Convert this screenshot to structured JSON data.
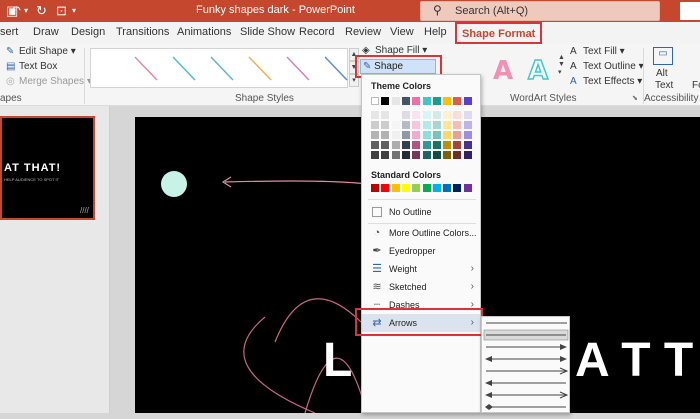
{
  "titlebar": {
    "autosave": "⏺",
    "undo_icon": "undo-icon",
    "document_title": "Funky shapes dark  -  PowerPoint",
    "search_placeholder": "Search (Alt+Q)",
    "accent": "#c4472e"
  },
  "tabs": [
    {
      "label": "sert"
    },
    {
      "label": "Draw"
    },
    {
      "label": "Design"
    },
    {
      "label": "Transitions"
    },
    {
      "label": "Animations"
    },
    {
      "label": "Slide Show"
    },
    {
      "label": "Record"
    },
    {
      "label": "Review"
    },
    {
      "label": "View"
    },
    {
      "label": "Help"
    },
    {
      "label": "Shape Format"
    }
  ],
  "ribbon": {
    "edit_shape": "Edit Shape",
    "text_box": "Text Box",
    "merge_shapes": "Merge Shapes",
    "shapes_group": "apes",
    "shape_styles_group": "Shape Styles",
    "shape_fill": "Shape Fill",
    "shape_outline": "Shape Outline",
    "wordart_group": "WordArt Styles",
    "text_fill": "Text Fill",
    "text_outline": "Text Outline",
    "text_effects": "Text Effects",
    "alt_text_1": "Alt",
    "alt_text_2": "Text",
    "accessibility_group": "Accessibility",
    "fo": "Fo",
    "gallery_line_colors": [
      "#e48ba1",
      "#4fc0d0",
      "#5fb5c4",
      "#f0b24b",
      "#d77fc0",
      "#5b8fd6"
    ]
  },
  "thumb": {
    "line1": "AT THAT!",
    "line2": "HELP AUDIENCE TO SPOT IT"
  },
  "slide": {
    "headline_left": "L O O",
    "headline_right": "A T  T"
  },
  "outline_menu": {
    "theme_colors_label": "Theme Colors",
    "standard_colors_label": "Standard Colors",
    "theme_top_row": [
      "#ffffff",
      "#000000",
      "#e7e6e6",
      "#44546a",
      "#f06fa8",
      "#3ec9c6",
      "#1f9b8a",
      "#ffc000",
      "#e05c4e",
      "#5b3fd1"
    ],
    "standard_colors": [
      "#c00000",
      "#ff0000",
      "#ffc000",
      "#ffff00",
      "#92d050",
      "#00b050",
      "#00b0f0",
      "#0070c0",
      "#002060",
      "#7030a0"
    ],
    "no_outline": "No Outline",
    "more_outline_colors": "More Outline Colors...",
    "eyedropper": "Eyedropper",
    "weight": "Weight",
    "sketched": "Sketched",
    "dashes": "Dashes",
    "arrows": "Arrows"
  }
}
